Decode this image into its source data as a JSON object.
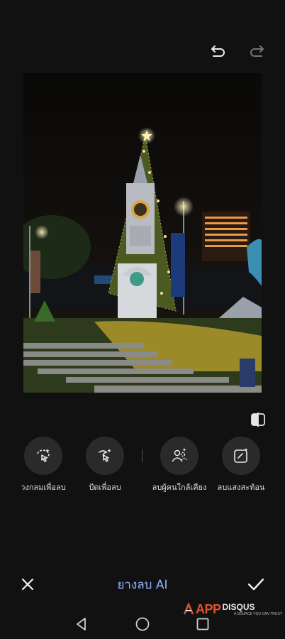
{
  "toolbar": {
    "undo_icon": "undo-icon",
    "redo_icon": "redo-icon"
  },
  "photo": {
    "description_icon": "photo-preview"
  },
  "tools": [
    {
      "label": "วงกลมเพื่อลบ",
      "icon": "lasso-erase-icon"
    },
    {
      "label": "ปัดเพื่อลบ",
      "icon": "brush-erase-icon"
    },
    {
      "label": "ลบผู้คนใกล้เคียง",
      "icon": "remove-people-icon"
    },
    {
      "label": "ลบแสงสะท้อน",
      "icon": "remove-reflection-icon"
    }
  ],
  "bottom": {
    "title": "ยางลบ AI",
    "cancel_icon": "close-icon",
    "confirm_icon": "check-icon"
  },
  "watermark": {
    "app": "APP",
    "disqus": "DISQUS",
    "tagline": "A SOURCE YOU CAN TRUST"
  },
  "colors": {
    "background": "#111112",
    "accent": "#8fb4ff",
    "tool_circle": "#2a2a2c"
  }
}
